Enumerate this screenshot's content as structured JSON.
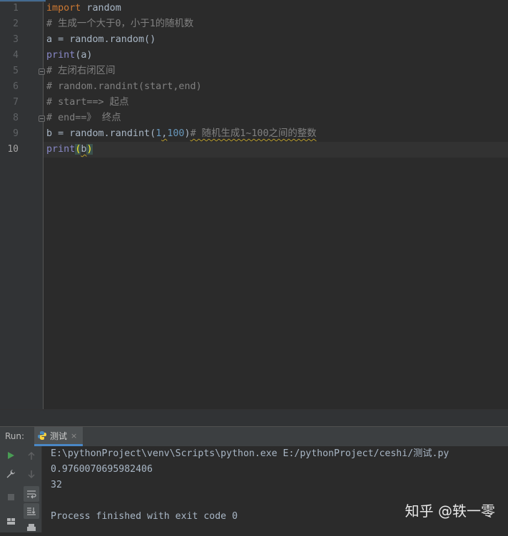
{
  "editor": {
    "line_numbers": [
      "1",
      "2",
      "3",
      "4",
      "5",
      "6",
      "7",
      "8",
      "9",
      "10"
    ],
    "lines": {
      "l1_kw": "import",
      "l1_rest": " random",
      "l2": "# 生成一个大于0，小于1的随机数",
      "l3": "a = random.random()",
      "l4_fn": "print",
      "l4_rest": "(a)",
      "l5": "# 左闭右闭区间",
      "l6": "# random.randint(start,end)",
      "l7": "# start==> 起点",
      "l8": "# end==》 终点",
      "l9_a": "b = random.randint(",
      "l9_n1": "1",
      "l9_comma": ",",
      "l9_n2": "100",
      "l9_close": ")",
      "l9_comment": "# 随机生成1~100之间的整数",
      "l10_fn": "print",
      "l10_open": "(",
      "l10_arg": "b",
      "l10_close": ")"
    },
    "current_line": "10"
  },
  "run_panel": {
    "label": "Run:",
    "tab_name": "测试",
    "tab_close": "×",
    "console_lines": [
      "E:\\pythonProject\\venv\\Scripts\\python.exe E:/pythonProject/ceshi/测试.py",
      "0.9760070695982406",
      "32",
      "",
      "Process finished with exit code 0"
    ],
    "toolbar_icons": [
      "run-icon",
      "wrench-icon",
      "stop-icon",
      "layout-icon",
      "up-arrow-icon",
      "down-arrow-icon",
      "soft-wrap-icon",
      "scroll-to-end-icon",
      "print-icon"
    ]
  },
  "watermark": "知乎 @轶一零",
  "colors": {
    "background": "#2b2b2b",
    "keyword": "#cc7832",
    "builtin": "#8888c6",
    "comment": "#808080",
    "number": "#6897bb",
    "text": "#a9b7c6",
    "run_green": "#499c54"
  }
}
